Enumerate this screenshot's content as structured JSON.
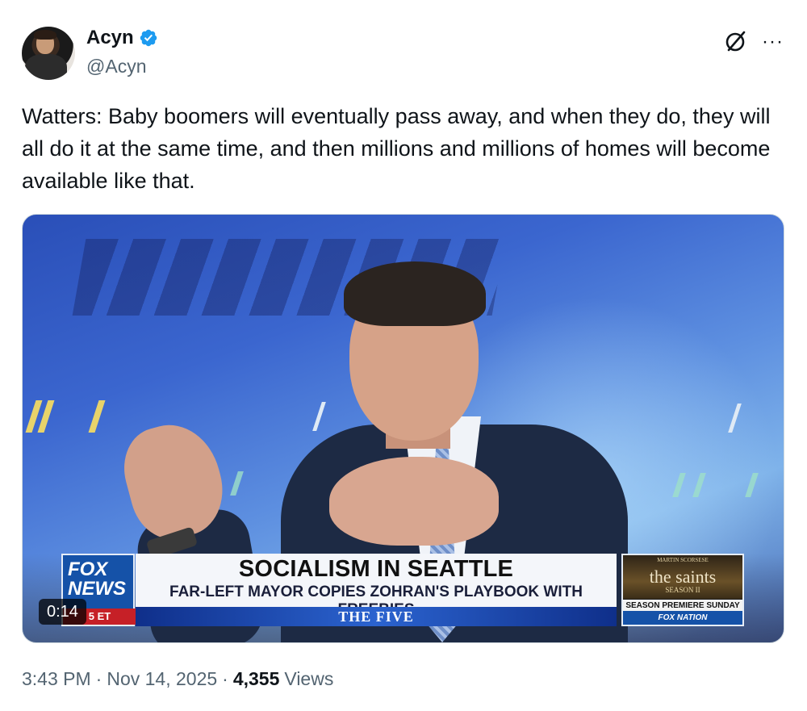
{
  "author": {
    "display_name": "Acyn",
    "handle": "@Acyn",
    "verified": true
  },
  "actions": {
    "grok_icon": "grok-icon",
    "more_icon": "more-icon",
    "more_glyph": "···"
  },
  "tweet": {
    "text": "Watters: Baby boomers will eventually pass away, and when they do, they will all do it at the same time, and then millions and millions of homes will become available like that."
  },
  "media": {
    "duration": "0:14",
    "chyron": {
      "logo_line1": "FOX",
      "logo_line2": "NEWS",
      "time": "5 ET",
      "headline": "SOCIALISM IN SEATTLE",
      "subhead": "FAR-LEFT MAYOR COPIES ZOHRAN'S PLAYBOOK WITH FREEBIES",
      "show": "THE FIVE"
    },
    "promo": {
      "credit": "MARTIN SCORSESE",
      "title": "the saints",
      "season": "SEASON II",
      "premiere": "SEASON PREMIERE SUNDAY",
      "network": "FOX NATION"
    }
  },
  "meta": {
    "time": "3:43 PM",
    "separator": "·",
    "date": "Nov 14, 2025",
    "views_count": "4,355",
    "views_label": "Views"
  },
  "colors": {
    "text": "#0f1419",
    "secondary": "#536471",
    "verified": "#1d9bf0"
  }
}
